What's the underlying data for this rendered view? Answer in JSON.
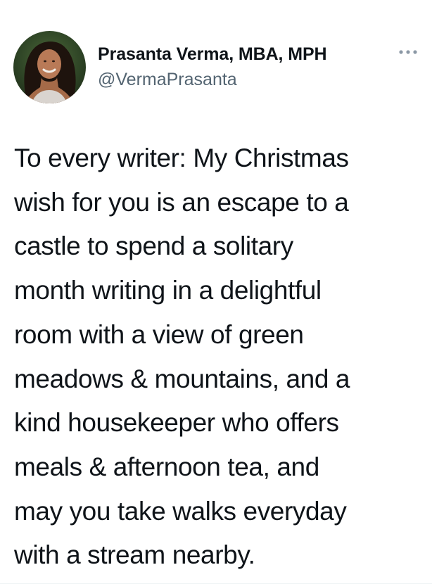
{
  "author": {
    "display_name": "Prasanta Verma, MBA, MPH",
    "handle": "@VermaPrasanta",
    "avatar_icon": "profile-photo"
  },
  "menu": {
    "icon": "more-horizontal-icon"
  },
  "tweet": {
    "lines": [
      "To every writer: My Christmas",
      "wish for you is an escape to a",
      "castle to spend a solitary",
      "month writing in a delightful",
      "room with a view of green",
      "meadows & mountains, and a",
      "kind housekeeper who offers",
      "meals & afternoon tea, and",
      "may you take walks everyday",
      "with a stream nearby."
    ]
  },
  "colors": {
    "text_primary": "#0f1419",
    "text_secondary": "#536471",
    "menu_dots": "#8b98a5"
  }
}
